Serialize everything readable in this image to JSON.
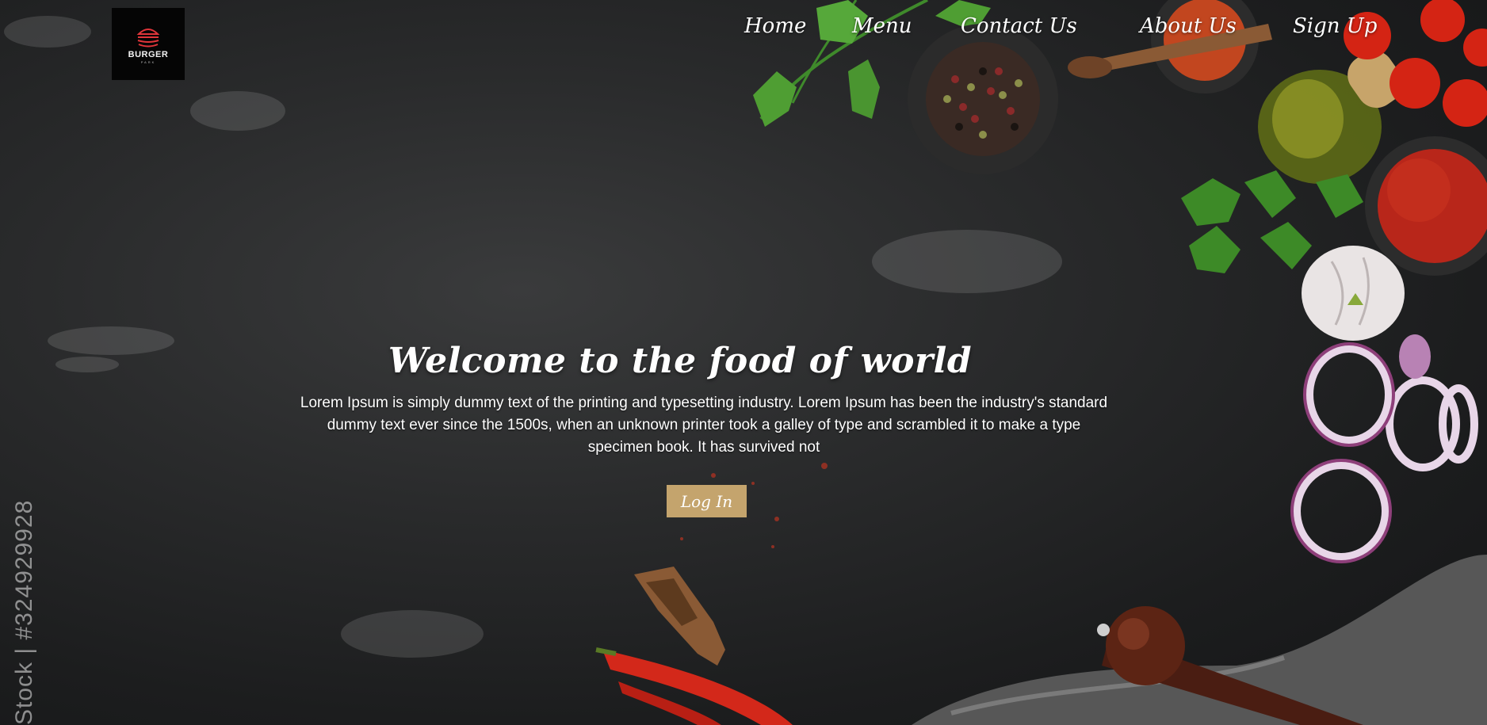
{
  "brand": {
    "logo_line1": "BURGER",
    "logo_line2": "PARK",
    "logo_color": "#e0353a"
  },
  "nav": {
    "items": [
      {
        "label": "Home"
      },
      {
        "label": "Menu"
      },
      {
        "label": "Contact Us"
      },
      {
        "label": "About Us"
      },
      {
        "label": "Sign Up"
      }
    ]
  },
  "hero": {
    "title": "Welcome to the food of world",
    "text": "Lorem Ipsum is simply dummy text of the printing and typesetting industry. Lorem Ipsum has been the industry's standard dummy text ever since the 1500s, when an unknown printer took a galley of type and scrambled it to make a type specimen book. It has survived not",
    "button_label": "Log In",
    "button_color": "#c4a46d"
  },
  "watermark": {
    "text": "Stock | #324929928"
  }
}
